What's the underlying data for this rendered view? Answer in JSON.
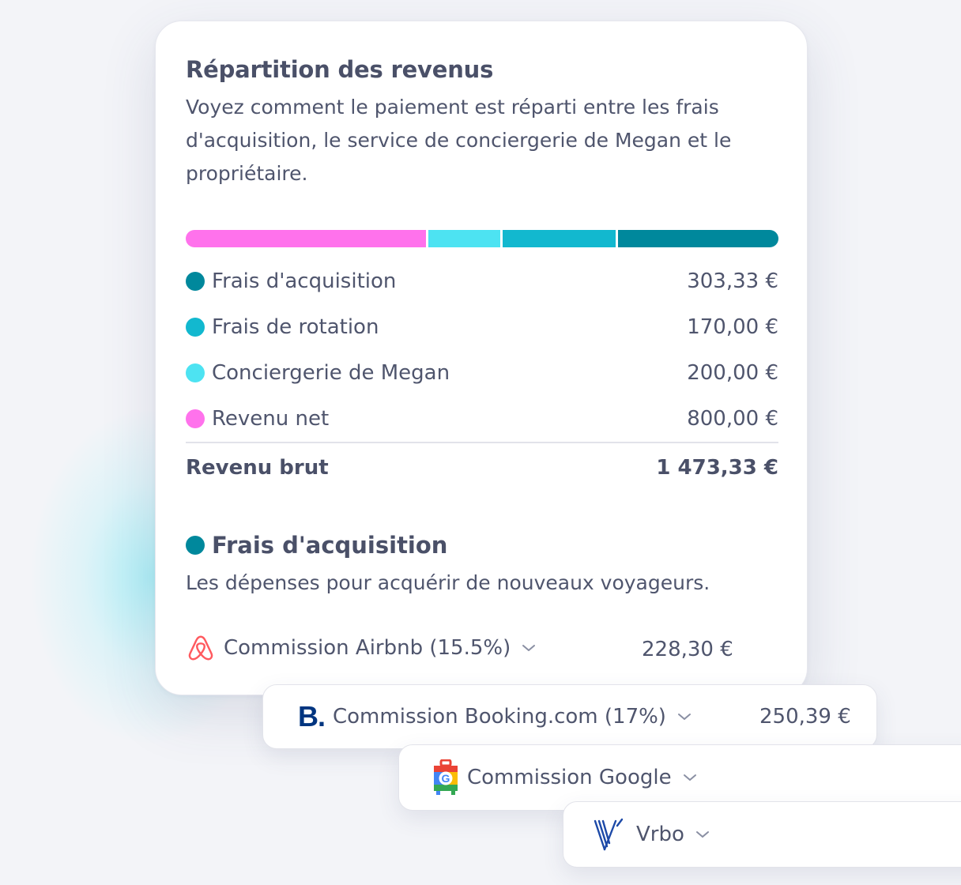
{
  "card": {
    "title": "Répartition des revenus",
    "subtitle": "Voyez comment le paiement est réparti entre les frais d'acquisition, le service de conciergerie de Megan et le propriétaire."
  },
  "colors": {
    "acquisition": "#00889c",
    "rotation": "#12b8cf",
    "conciergerie": "#4de3f2",
    "revenu_net": "#ff72ec"
  },
  "breakdown": [
    {
      "label": "Frais d'acquisition",
      "amount": "303,33 €",
      "value": 303.33,
      "color": "#00889c"
    },
    {
      "label": "Frais de rotation",
      "amount": "170,00 €",
      "value": 170.0,
      "color": "#12b8cf"
    },
    {
      "label": "Conciergerie de Megan",
      "amount": "200,00 €",
      "value": 200.0,
      "color": "#4de3f2"
    },
    {
      "label": "Revenu net",
      "amount": "800,00 €",
      "value": 800.0,
      "color": "#ff72ec"
    }
  ],
  "total": {
    "label": "Revenu brut",
    "amount": "1 473,33 €"
  },
  "acquisition_section": {
    "title": "Frais d'acquisition",
    "subtitle": "Les dépenses pour acquérir de nouveaux voyageurs."
  },
  "commissions": {
    "airbnb": {
      "label": "Commission Airbnb (15.5%)",
      "amount": "228,30 €",
      "icon": "airbnb-logo-icon"
    },
    "booking": {
      "label": "Commission Booking.com (17%)",
      "amount": "250,39 €",
      "logo_text": "B.",
      "icon": "booking-logo-icon"
    },
    "google": {
      "label": "Commission Google",
      "icon": "google-travel-logo-icon"
    },
    "vrbo": {
      "label": "Vrbo",
      "icon": "vrbo-logo-icon"
    }
  }
}
